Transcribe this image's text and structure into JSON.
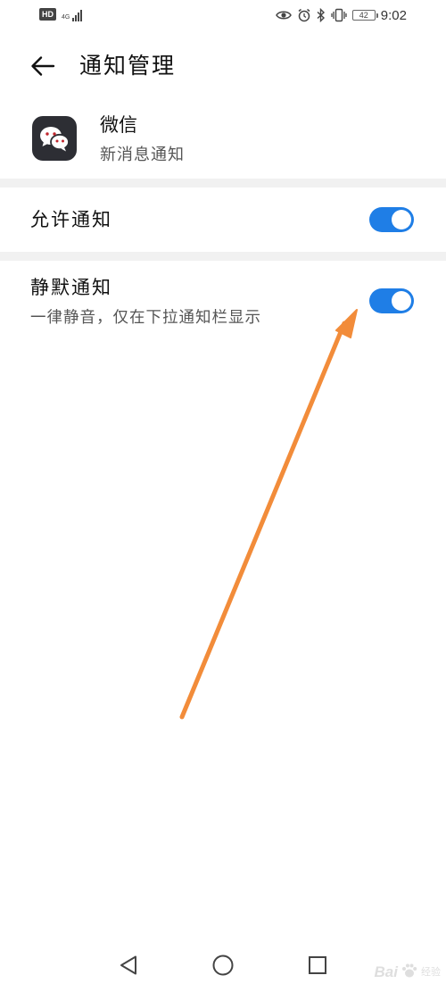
{
  "status_bar": {
    "hd_label": "HD",
    "network_label": "4G",
    "battery_level": "42",
    "time": "9:02"
  },
  "header": {
    "title": "通知管理"
  },
  "app": {
    "name": "微信",
    "subtitle": "新消息通知",
    "icon": "wechat-icon",
    "icon_bg": "#2d2e34"
  },
  "settings": {
    "allow": {
      "title": "允许通知",
      "enabled": true
    },
    "silent": {
      "title": "静默通知",
      "description": "一律静音，仅在下拉通知栏显示",
      "enabled": true
    }
  },
  "colors": {
    "toggle_on": "#1f7ee6",
    "annotation_arrow": "#f28c3a",
    "section_band": "#f1f1f1"
  },
  "watermark": {
    "brand": "Bai",
    "suffix": "经验"
  }
}
